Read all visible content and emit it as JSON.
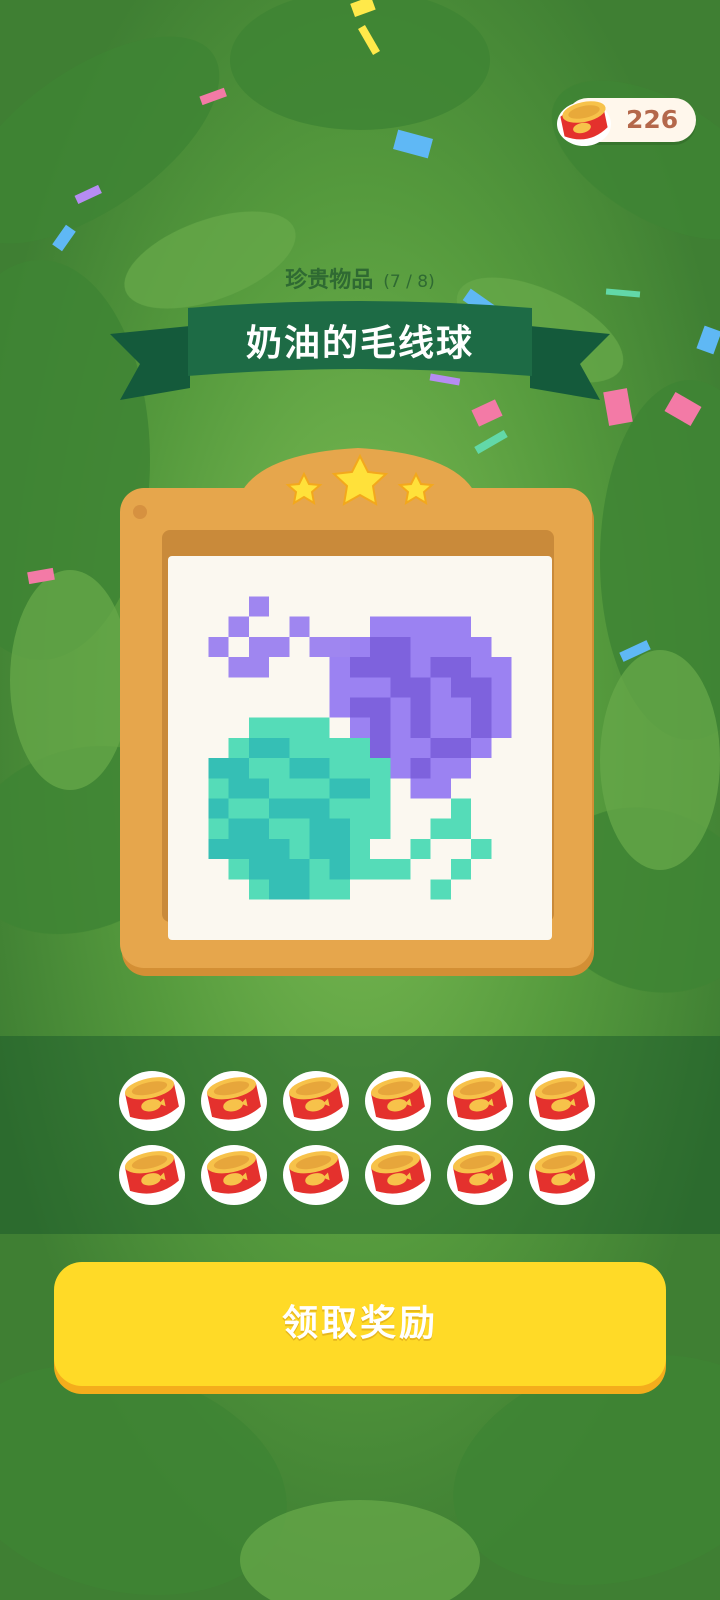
{
  "hud": {
    "coin_count": "226",
    "coin_icon": "fish-can-icon"
  },
  "header": {
    "category_label": "珍贵物品",
    "progress": "(7 / 8)",
    "item_title": "奶油的毛线球"
  },
  "item": {
    "star_rating": 3,
    "max_stars": 3,
    "image": "yarn-balls-pixel-art"
  },
  "rewards": {
    "item_icon": "fish-can-icon",
    "count": 12
  },
  "actions": {
    "claim_label": "领取奖励"
  },
  "colors": {
    "background_green": "#4f8f3a",
    "ribbon_green": "#1d6b45",
    "frame_orange": "#e6a64c",
    "yarn_purple": "#8a6ee8",
    "yarn_teal": "#3fc7b7",
    "button_yellow": "#ffda27",
    "can_red": "#e4312d"
  }
}
